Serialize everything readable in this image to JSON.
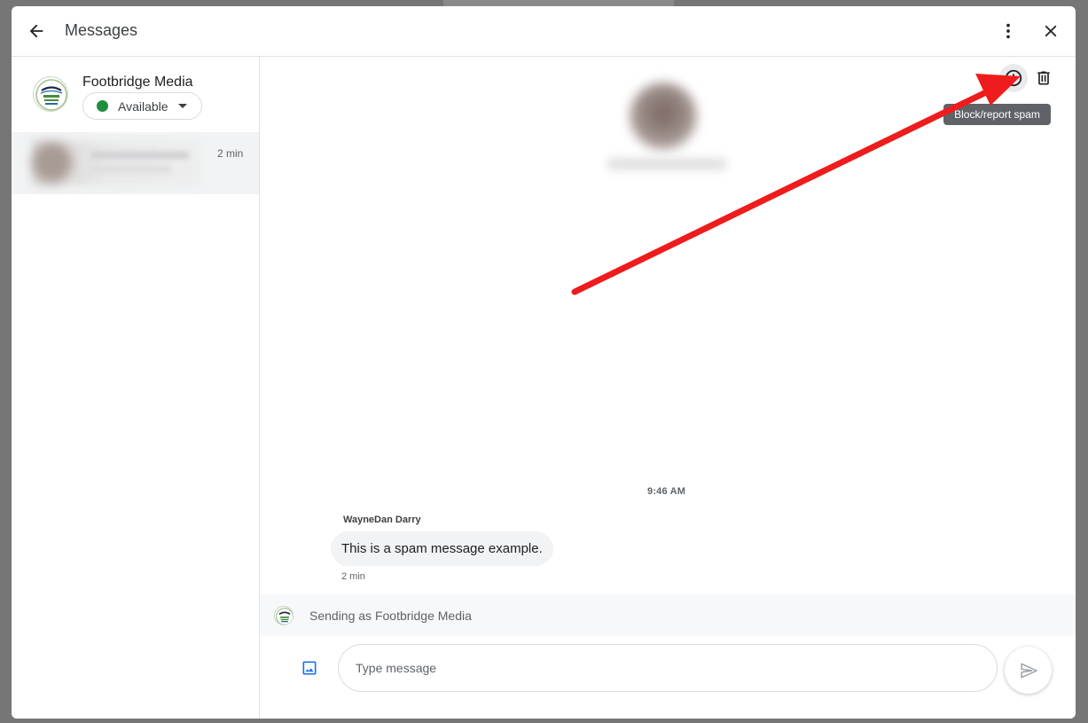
{
  "header": {
    "title": "Messages",
    "back_icon": "arrow-back-icon",
    "more_icon": "more-vert-icon",
    "close_icon": "close-icon"
  },
  "business": {
    "name": "Footbridge Media",
    "status": "Available",
    "status_color": "#1e8e3e"
  },
  "conversations": [
    {
      "time": "2 min"
    }
  ],
  "thread_actions": {
    "spam_icon": "report-spam-icon",
    "delete_icon": "delete-icon",
    "spam_tooltip": "Block/report spam"
  },
  "thread": {
    "time_divider": "9:46 AM",
    "messages": [
      {
        "sender": "WayneDan Darry",
        "text": "This is a spam message example.",
        "time": "2 min"
      }
    ]
  },
  "composer": {
    "sending_as": "Sending as Footbridge Media",
    "placeholder": "Type message",
    "image_icon": "image-icon",
    "send_icon": "send-icon"
  },
  "colors": {
    "annotation_arrow": "#ee1c1c",
    "accent_blue": "#1a73e8",
    "selected_row": "#f1f3f4"
  }
}
